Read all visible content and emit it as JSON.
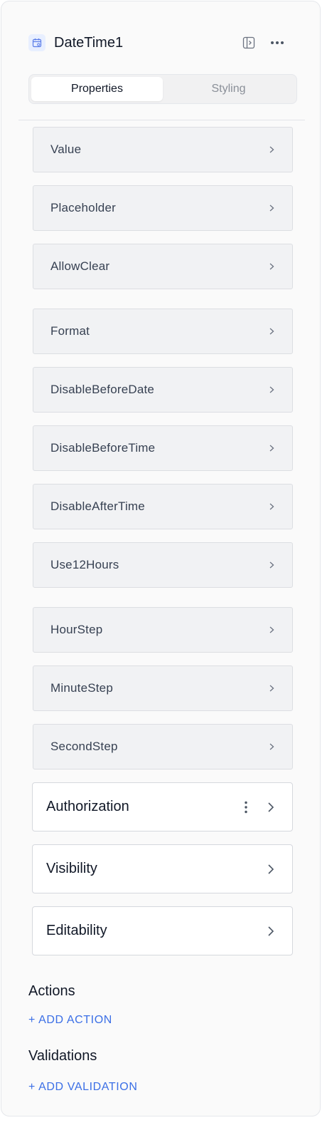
{
  "component": {
    "title": "DateTime1",
    "icon": "calendar-icon"
  },
  "tabs": [
    {
      "label": "Properties",
      "active": true
    },
    {
      "label": "Styling",
      "active": false
    }
  ],
  "properties": [
    {
      "label": "Value"
    },
    {
      "label": "Placeholder"
    },
    {
      "label": "AllowClear"
    },
    {
      "label": "Format"
    },
    {
      "label": "DisableBeforeDate"
    },
    {
      "label": "DisableBeforeTime"
    },
    {
      "label": "DisableAfterTime"
    },
    {
      "label": "Use12Hours"
    },
    {
      "label": "HourStep"
    },
    {
      "label": "MinuteStep"
    },
    {
      "label": "SecondStep"
    }
  ],
  "sections": [
    {
      "label": "Authorization",
      "has_menu": true
    },
    {
      "label": "Visibility",
      "has_menu": false
    },
    {
      "label": "Editability",
      "has_menu": false
    }
  ],
  "actions": {
    "title": "Actions",
    "add_label": "+ ADD ACTION"
  },
  "validations": {
    "title": "Validations",
    "add_label": "+ ADD VALIDATION"
  },
  "colors": {
    "accent": "#3b6fe6",
    "row_bg": "#f1f2f4",
    "panel_bg": "#fafafa"
  }
}
